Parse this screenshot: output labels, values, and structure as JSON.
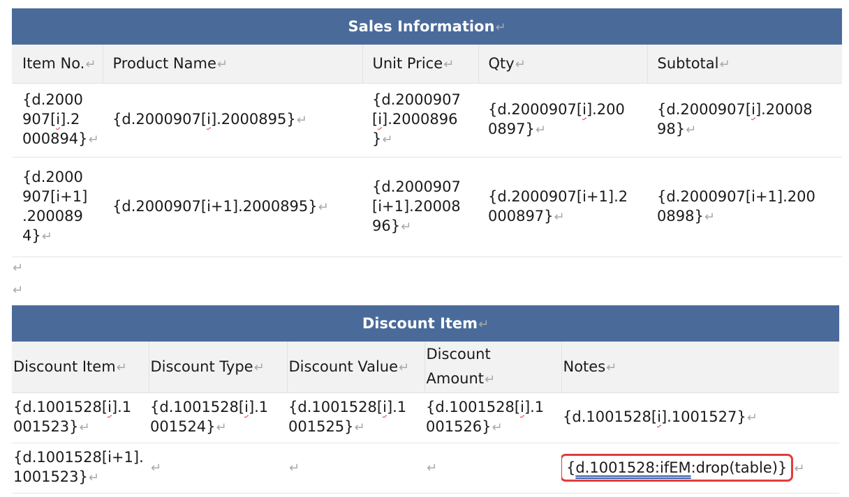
{
  "sales": {
    "title": "Sales Information",
    "headers": [
      "Item No.",
      "Product Name",
      "Unit Price",
      "Qty",
      "Subtotal"
    ],
    "row1": {
      "c1_a": "{d.2000",
      "c1_b": "907[",
      "c1_i": "i",
      "c1_c": "].2",
      "c1_d": "000894}",
      "c2_a": "{d.2000907[",
      "c2_i": "i",
      "c2_b": "].2000895}",
      "c3_a": "{d.2000907",
      "c3_b": "[",
      "c3_i": "i",
      "c3_c": "].2000896",
      "c3_d": "}",
      "c4_a": "{d.2000907[",
      "c4_i": "i",
      "c4_b": "].200",
      "c4_c": "0897}",
      "c5_a": "{d.2000907[",
      "c5_i": "i",
      "c5_b": "].20008",
      "c5_c": "98}"
    },
    "row2": {
      "c1_a": "{d.2000",
      "c1_b": "907[i+1]",
      "c1_c": ".200089",
      "c1_d": "4}",
      "c2": "{d.2000907[i+1].2000895}",
      "c3_a": "{d.2000907",
      "c3_b": "[i+1].20008",
      "c3_c": "96}",
      "c4_a": "{d.2000907[i+1].2",
      "c4_b": "000897}",
      "c5_a": "{d.2000907[i+1].200",
      "c5_b": "0898}"
    }
  },
  "discount": {
    "title": "Discount Item",
    "headers": [
      "Discount Item",
      "Discount Type",
      "Discount Value",
      "Discount",
      "Amount",
      "Notes"
    ],
    "row1": {
      "c1_a": "{d.1001528[",
      "c1_i": "i",
      "c1_b": "].1",
      "c1_c": "001523}",
      "c2_a": "{d.1001528[",
      "c2_i": "i",
      "c2_b": "].1",
      "c2_c": "001524}",
      "c3_a": "{d.1001528[",
      "c3_i": "i",
      "c3_b": "].1",
      "c3_c": "001525}",
      "c4_a": "{d.1001528[",
      "c4_i": "i",
      "c4_b": "].1",
      "c4_c": "001526}",
      "c5_a": "{d.1001528[",
      "c5_i": "i",
      "c5_b": "].1001527}"
    },
    "row2": {
      "c1_a": "{d.1001528[i+1].",
      "c1_b": "1001523}",
      "c5_open": "{",
      "c5_link": "d.1001528:ifEM",
      "c5_rest": ":drop(table)}"
    }
  },
  "paragraph_mark": "↵"
}
